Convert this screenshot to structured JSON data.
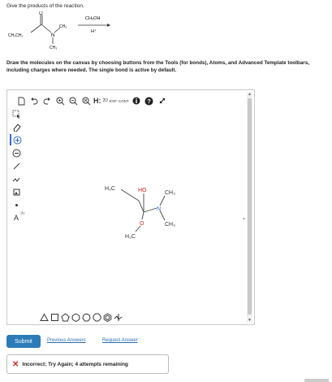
{
  "question": "Give the products of the reaction.",
  "reaction": {
    "reagent": "CH₃OH",
    "catalyst": "H⁺",
    "labels": {
      "left_ethyl": "CH₃CH₂",
      "n_methyl_top": "CH₃",
      "n_atom": "N",
      "n_methyl_bottom": "CH₃"
    }
  },
  "instructions": "Draw the molecules on the canvas by choosing buttons from the Tools (for bonds), Atoms, and Advanced Template toolbars, including charges where needed. The single bond is active by default.",
  "toolbar": {
    "h_label": "H:",
    "label_2d": "2D",
    "label_exp": "EXP",
    "label_cont": "CONT"
  },
  "left_toolbar": {
    "atom_label": "A",
    "atom_sup": "[1]"
  },
  "molecule": {
    "ho": "HO",
    "h3c_left": "H₃C",
    "n": "N",
    "ch3_top": "CH₃",
    "ch3_bottom": "CH₃",
    "o": "O",
    "h3c_bottom": "H₃C"
  },
  "actions": {
    "submit": "Submit",
    "previous_answers": "Previous Answers",
    "request_answer": "Request Answer"
  },
  "feedback": {
    "message": "Incorrect; Try Again; 4 attempts remaining"
  },
  "colors": {
    "accent": "#2b7bb9",
    "error": "#d0271d",
    "oxygen": "#d0271d",
    "nitrogen": "#2a6cc8"
  }
}
